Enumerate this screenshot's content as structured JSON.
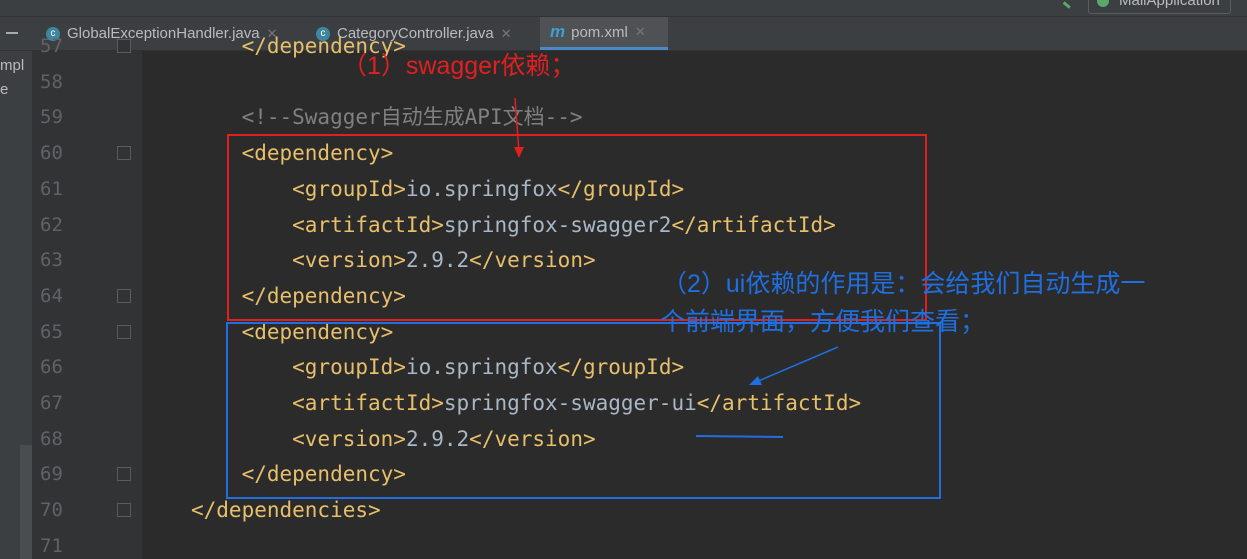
{
  "run_config": "MallApplication",
  "tabs": [
    {
      "label": "GlobalExceptionHandler.java",
      "icon": "class-icon"
    },
    {
      "label": "CategoryController.java",
      "icon": "class-icon"
    },
    {
      "label": "pom.xml",
      "icon": "maven-icon",
      "active": true
    }
  ],
  "left_panel": [
    "mpl",
    "e"
  ],
  "lines": [
    {
      "n": "57",
      "indent": "    ",
      "parts": [
        [
          "tag",
          "</dependency>"
        ]
      ]
    },
    {
      "n": "58",
      "indent": "",
      "parts": []
    },
    {
      "n": "59",
      "indent": "    ",
      "parts": [
        [
          "cmt",
          "<!--Swagger自动生成API文档-->"
        ]
      ]
    },
    {
      "n": "60",
      "indent": "    ",
      "parts": [
        [
          "tag",
          "<dependency>"
        ]
      ]
    },
    {
      "n": "61",
      "indent": "        ",
      "parts": [
        [
          "tag",
          "<groupId>"
        ],
        [
          "txt",
          "io.springfox"
        ],
        [
          "tag",
          "</groupId>"
        ]
      ]
    },
    {
      "n": "62",
      "indent": "        ",
      "parts": [
        [
          "tag",
          "<artifactId>"
        ],
        [
          "txt",
          "springfox-swagger2"
        ],
        [
          "tag",
          "</artifactId>"
        ]
      ]
    },
    {
      "n": "63",
      "indent": "        ",
      "parts": [
        [
          "tag",
          "<version>"
        ],
        [
          "txt",
          "2.9.2"
        ],
        [
          "tag",
          "</version>"
        ]
      ]
    },
    {
      "n": "64",
      "indent": "    ",
      "parts": [
        [
          "tag",
          "</dependency>"
        ]
      ]
    },
    {
      "n": "65",
      "indent": "    ",
      "parts": [
        [
          "tag",
          "<dependency>"
        ]
      ]
    },
    {
      "n": "66",
      "indent": "        ",
      "parts": [
        [
          "tag",
          "<groupId>"
        ],
        [
          "txt",
          "io.springfox"
        ],
        [
          "tag",
          "</groupId>"
        ]
      ]
    },
    {
      "n": "67",
      "indent": "        ",
      "parts": [
        [
          "tag",
          "<artifactId>"
        ],
        [
          "txt",
          "springfox-swagger-ui"
        ],
        [
          "tag",
          "</artifactId>"
        ]
      ]
    },
    {
      "n": "68",
      "indent": "        ",
      "parts": [
        [
          "tag",
          "<version>"
        ],
        [
          "txt",
          "2.9.2"
        ],
        [
          "tag",
          "</version>"
        ]
      ]
    },
    {
      "n": "69",
      "indent": "    ",
      "parts": [
        [
          "tag",
          "</dependency>"
        ]
      ]
    },
    {
      "n": "70",
      "indent": "",
      "parts": [
        [
          "tag",
          "</dependencies>"
        ]
      ]
    },
    {
      "n": "71",
      "indent": "",
      "parts": []
    }
  ],
  "annotations": {
    "a1": "（1）swagger依赖；",
    "a2_line1": "（2）ui依赖的作用是：会给我们自动生成一",
    "a2_line2": "个前端界面，方便我们查看；",
    "red": "#e02020",
    "blue": "#1f6fe0"
  }
}
